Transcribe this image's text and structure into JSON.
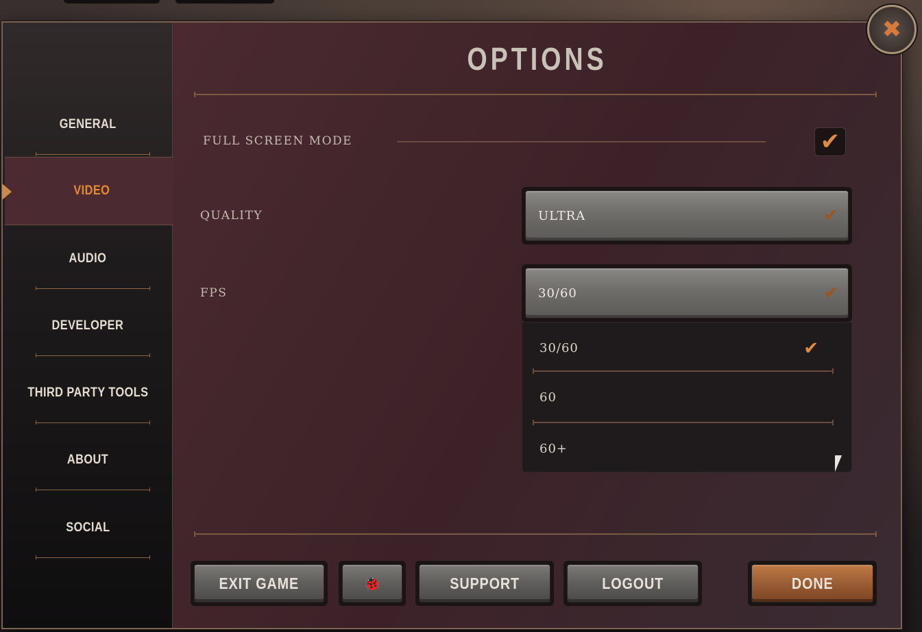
{
  "title": "OPTIONS",
  "sidebar": {
    "items": [
      {
        "label": "GENERAL",
        "active": false
      },
      {
        "label": "VIDEO",
        "active": true
      },
      {
        "label": "AUDIO",
        "active": false
      },
      {
        "label": "DEVELOPER",
        "active": false
      },
      {
        "label": "THIRD PARTY TOOLS",
        "active": false
      },
      {
        "label": "ABOUT",
        "active": false
      },
      {
        "label": "SOCIAL",
        "active": false
      }
    ]
  },
  "settings": {
    "fullscreen": {
      "label": "FULL SCREEN MODE",
      "checked": true,
      "check_icon": "checkmark-icon"
    },
    "quality": {
      "label": "QUALITY",
      "value": "ULTRA"
    },
    "fps": {
      "label": "FPS",
      "value": "30/60",
      "options": [
        {
          "label": "30/60",
          "selected": true
        },
        {
          "label": "60",
          "selected": false
        },
        {
          "label": "60+",
          "selected": false
        }
      ]
    }
  },
  "footer": {
    "exit_label": "EXIT GAME",
    "bug_icon": "bug-report-icon",
    "support_label": "SUPPORT",
    "logout_label": "LOGOUT",
    "done_label": "DONE"
  },
  "icons": {
    "close": "close-icon",
    "dropdown": "chevron-down-icon"
  },
  "colors": {
    "accent": "#e08c3c",
    "panel": "#3f2328",
    "text": "#c8bdb1"
  }
}
